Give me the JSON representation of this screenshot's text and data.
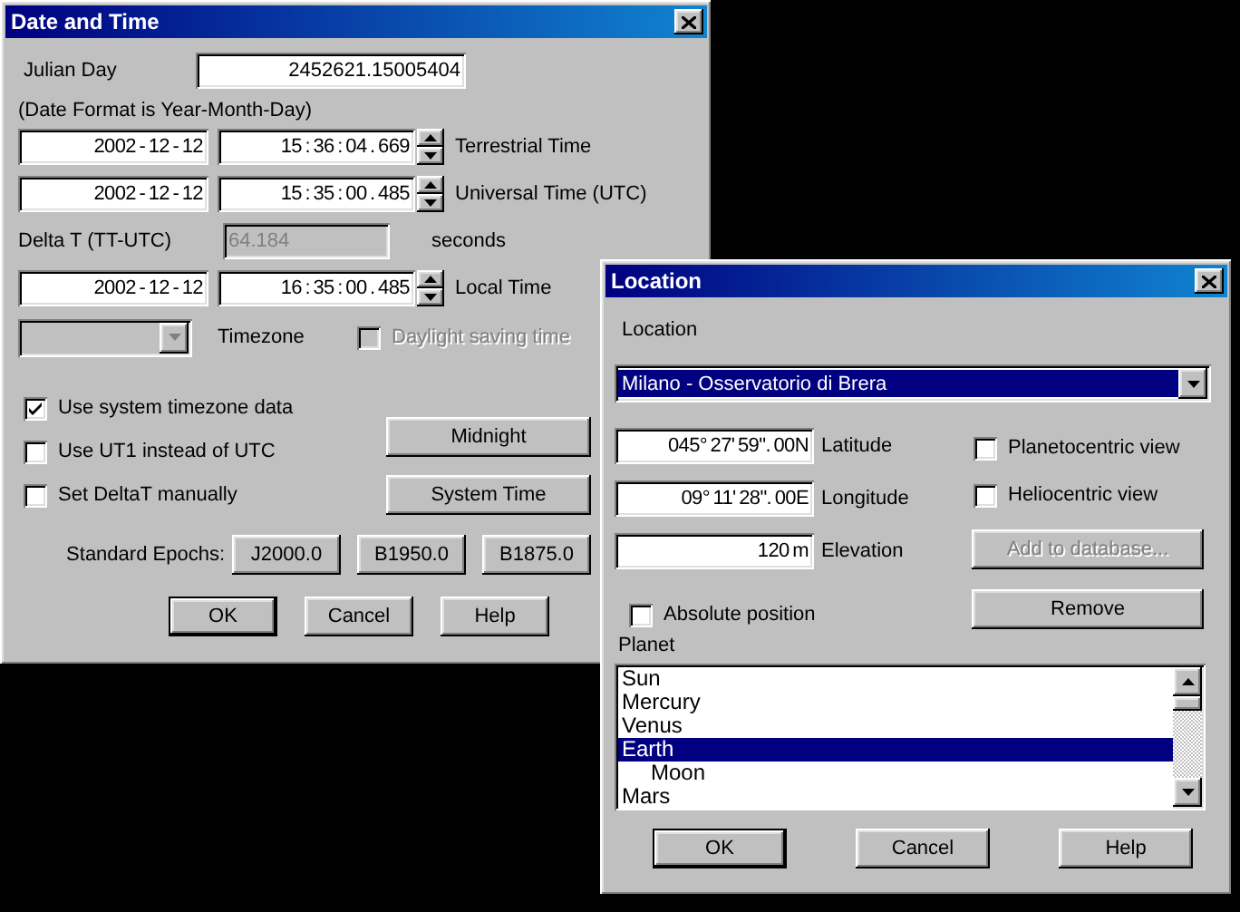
{
  "date_time": {
    "title": "Date and Time",
    "julian_day": {
      "label": "Julian Day",
      "value": "2452621.15005404"
    },
    "format_note": "(Date Format is Year-Month-Day)",
    "time_rows": [
      {
        "date": "2002 - 12 - 12",
        "time": "15 : 36 : 04 . 669",
        "label": "Terrestrial Time"
      },
      {
        "date": "2002 - 12 - 12",
        "time": "15 : 35 : 00 . 485",
        "label": "Universal Time (UTC)"
      }
    ],
    "delta_t": {
      "label": "Delta T (TT-UTC)",
      "value": "64.184",
      "unit": "seconds",
      "disabled": true
    },
    "local_row": {
      "date": "2002 - 12 - 12",
      "time": "16 : 35 : 00 . 485",
      "label": "Local Time"
    },
    "timezone": {
      "label": "Timezone",
      "disabled": true
    },
    "daylight": {
      "label": "Daylight saving time",
      "checked": false,
      "disabled": true
    },
    "checkboxes": [
      {
        "label": "Use system timezone data",
        "checked": true
      },
      {
        "label": "Use UT1 instead of UTC",
        "checked": false
      },
      {
        "label": "Set DeltaT manually",
        "checked": false
      }
    ],
    "side_buttons": [
      "Midnight",
      "System Time"
    ],
    "epochs": {
      "label": "Standard Epochs:",
      "buttons": [
        "J2000.0",
        "B1950.0",
        "B1875.0"
      ]
    },
    "footer": [
      {
        "label": "OK",
        "default": true
      },
      {
        "label": "Cancel",
        "default": false
      },
      {
        "label": "Help",
        "default": false
      }
    ]
  },
  "location": {
    "title": "Location",
    "location_label": "Location",
    "combo": {
      "value": "Milano - Osservatorio di Brera",
      "highlighted": true
    },
    "coords": [
      {
        "value": "045° 27' 59\". 00N",
        "label": "Latitude"
      },
      {
        "value": "09° 11' 28\". 00E",
        "label": "Longitude"
      },
      {
        "value": "120 m",
        "label": "Elevation"
      }
    ],
    "views": [
      {
        "label": "Planetocentric view",
        "checked": false
      },
      {
        "label": "Heliocentric view",
        "checked": false
      }
    ],
    "add_button": {
      "label": "Add to database...",
      "disabled": true
    },
    "remove_button": {
      "label": "Remove",
      "disabled": false
    },
    "absolute": {
      "label": "Absolute position",
      "checked": false
    },
    "planet_label": "Planet",
    "planets": [
      {
        "label": "Sun",
        "selected": false
      },
      {
        "label": "Mercury",
        "selected": false
      },
      {
        "label": "Venus",
        "selected": false
      },
      {
        "label": "Earth",
        "selected": true,
        "children": [
          {
            "label": "Moon",
            "selected": false
          }
        ]
      },
      {
        "label": "Mars",
        "selected": false
      }
    ],
    "footer": [
      {
        "label": "OK",
        "default": true
      },
      {
        "label": "Cancel",
        "default": false
      },
      {
        "label": "Help",
        "default": false
      }
    ]
  }
}
